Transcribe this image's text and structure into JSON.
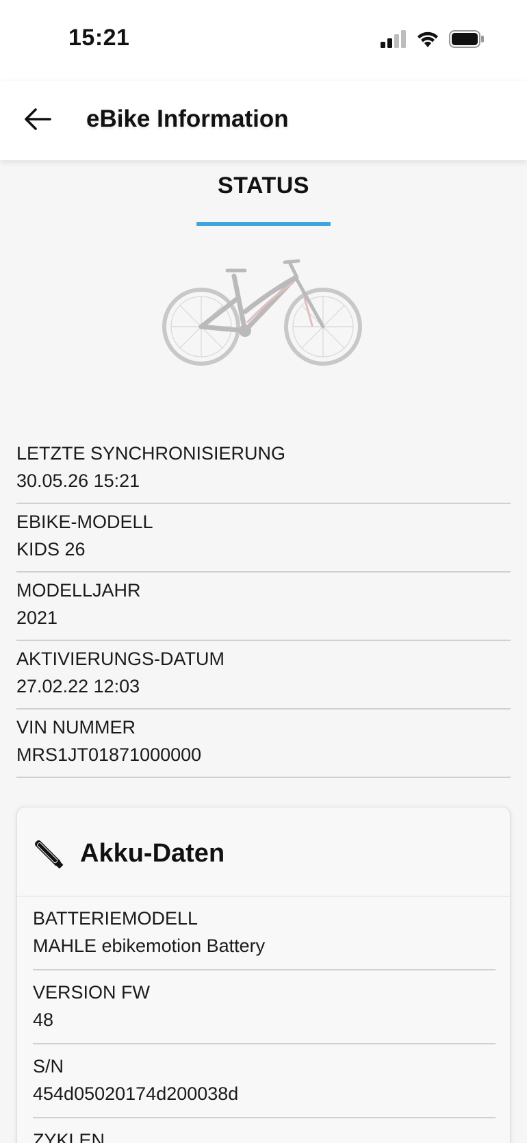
{
  "status_bar": {
    "time": "15:21"
  },
  "header": {
    "title": "eBike Information"
  },
  "tabs": [
    {
      "label": "STATUS",
      "active": true
    }
  ],
  "colors": {
    "accent": "#3ca6dd",
    "background": "#f6f6f6"
  },
  "info_rows": [
    {
      "label": "LETZTE SYNCHRONISIERUNG",
      "value": "30.05.26 15:21"
    },
    {
      "label": "EBIKE-MODELL",
      "value": "KIDS 26"
    },
    {
      "label": "MODELLJAHR",
      "value": "2021"
    },
    {
      "label": "AKTIVIERUNGS-DATUM",
      "value": "27.02.22 12:03"
    },
    {
      "label": "VIN NUMMER",
      "value": "MRS1JT01871000000"
    }
  ],
  "battery_card": {
    "title": "Akku-Daten",
    "icon": "battery-tube-icon",
    "rows": [
      {
        "label": "BATTERIEMODELL",
        "value": "MAHLE ebikemotion Battery"
      },
      {
        "label": "VERSION FW",
        "value": "48"
      },
      {
        "label": "S/N",
        "value": "454d05020174d200038d"
      },
      {
        "label": "ZYKLEN",
        "value": ""
      }
    ]
  }
}
